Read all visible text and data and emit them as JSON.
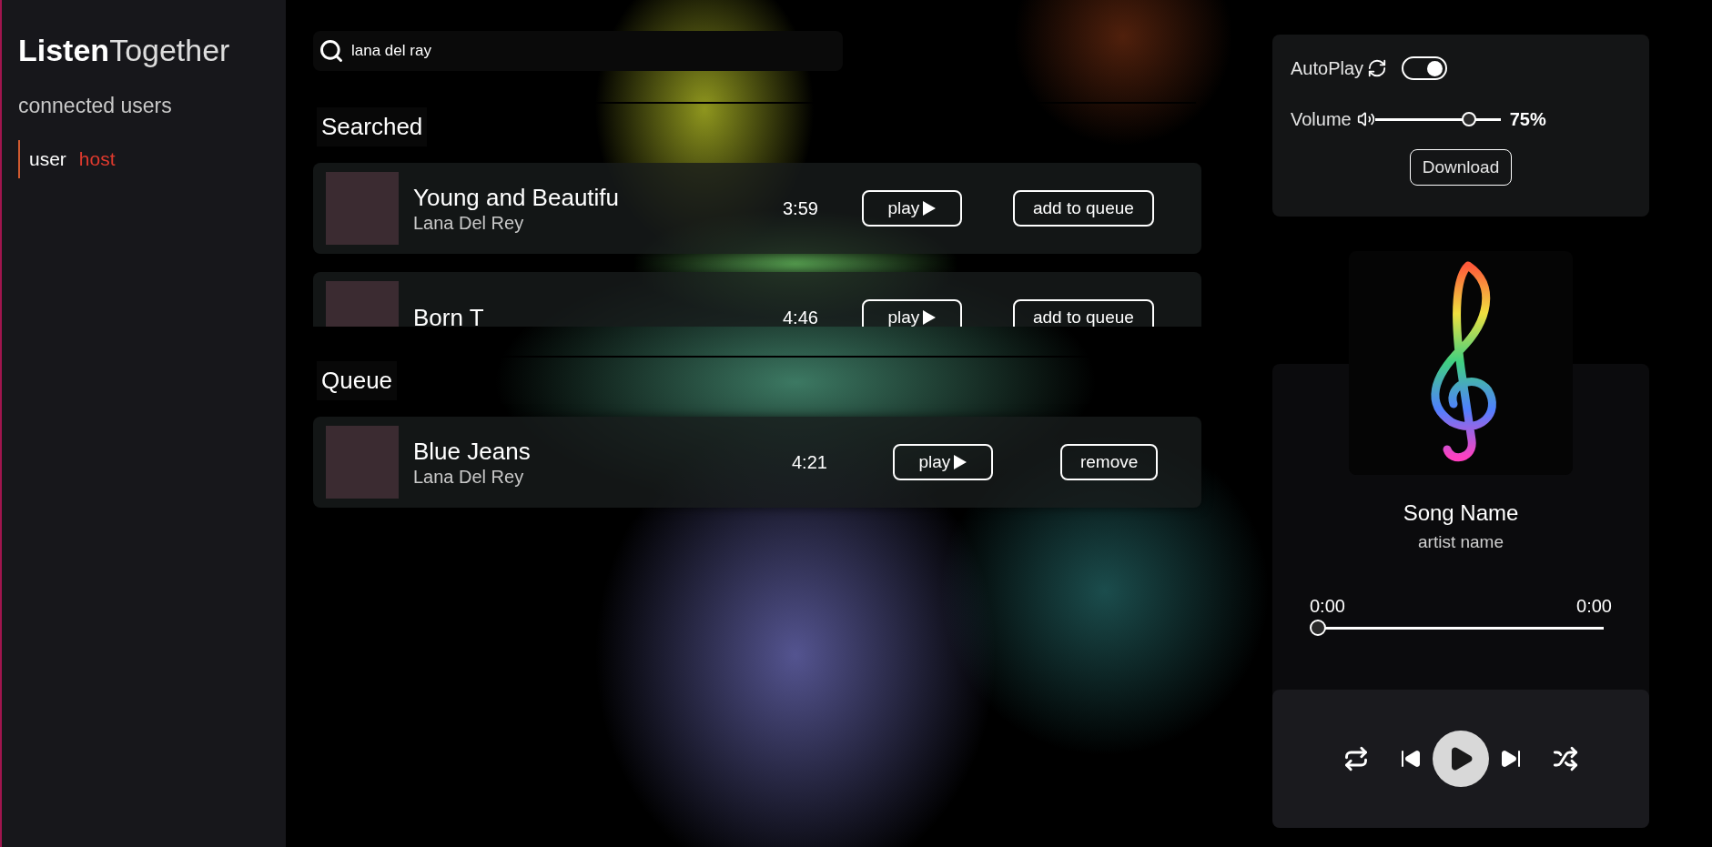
{
  "logo": {
    "bold": "Listen",
    "light": "Together"
  },
  "sidebar": {
    "heading": "connected users",
    "users": [
      {
        "name": "user",
        "role": "host"
      }
    ]
  },
  "search": {
    "value": "lana del ray"
  },
  "searched": {
    "title": "Searched",
    "songs": [
      {
        "title": "Young and Beautifu",
        "artist": "Lana Del Rey",
        "duration": "3:59",
        "play": "play",
        "action": "add to queue"
      },
      {
        "title": "Born T",
        "duration": "4:46",
        "play": "play",
        "action": "add to queue"
      }
    ]
  },
  "queue": {
    "title": "Queue",
    "songs": [
      {
        "title": "Blue Jeans",
        "artist": "Lana Del Rey",
        "duration": "4:21",
        "play": "play",
        "action": "remove"
      }
    ]
  },
  "settings": {
    "autoplay_label": "AutoPlay",
    "autoplay_on": true,
    "volume_label": "Volume",
    "volume": {
      "level": 0.75
    },
    "volume_reading": "75%",
    "download": "Download"
  },
  "player": {
    "song": "Song Name",
    "artist": "artist name",
    "elapsed": "0:00",
    "total": "0:00",
    "progress": {
      "level": 0
    }
  }
}
